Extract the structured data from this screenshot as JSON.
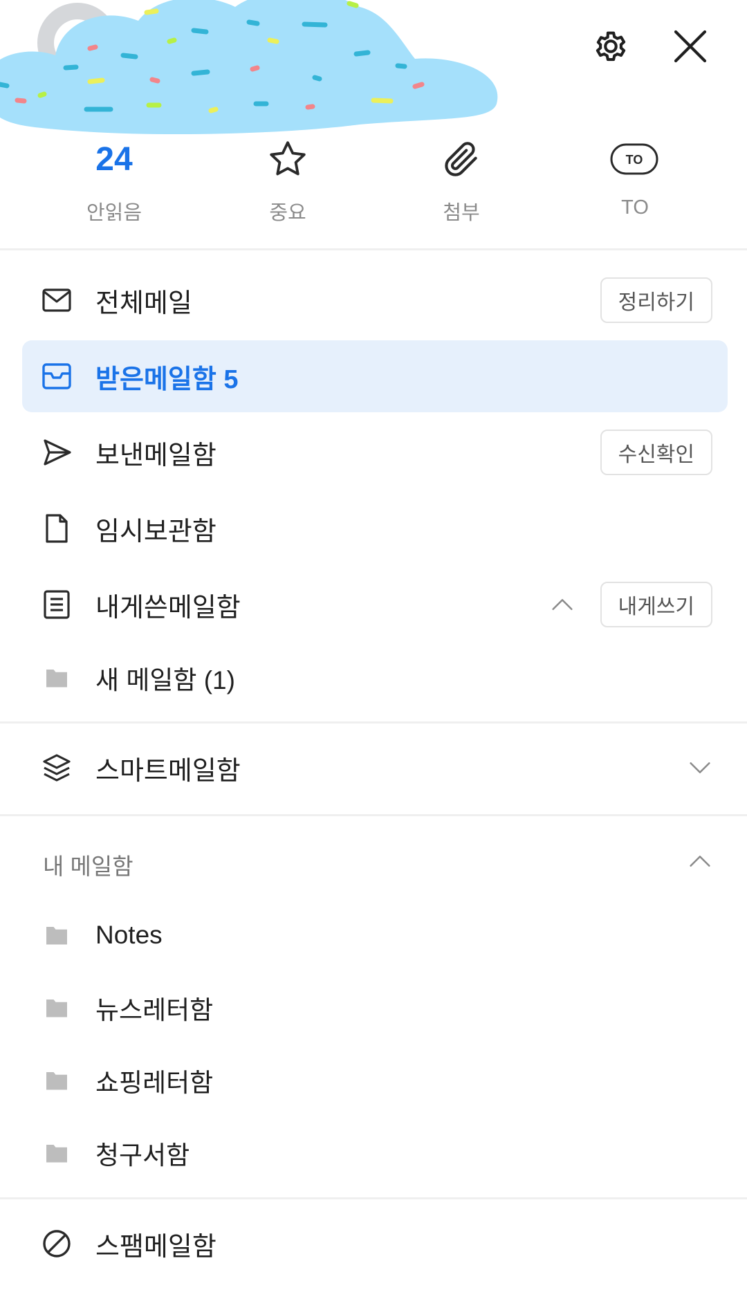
{
  "header": {
    "settings_icon": "gear-icon",
    "close_icon": "close-icon",
    "quick_filters": [
      {
        "label": "안읽음",
        "value": "24"
      },
      {
        "label": "중요",
        "icon": "star-icon"
      },
      {
        "label": "첨부",
        "icon": "paperclip-icon"
      },
      {
        "label": "TO",
        "icon": "to-badge-icon",
        "badge": "TO"
      }
    ]
  },
  "mailboxes": {
    "all": {
      "label": "전체메일",
      "action": "정리하기"
    },
    "inbox": {
      "label": "받은메일함",
      "count": "5"
    },
    "sent": {
      "label": "보낸메일함",
      "action": "수신확인"
    },
    "drafts": {
      "label": "임시보관함"
    },
    "self": {
      "label": "내게쓴메일함",
      "action": "내게쓰기"
    },
    "self_sub": {
      "label": "새 메일함 (1)"
    },
    "smart": {
      "label": "스마트메일함"
    }
  },
  "my_mailboxes": {
    "title": "내 메일함",
    "items": [
      {
        "label": "Notes"
      },
      {
        "label": "뉴스레터함"
      },
      {
        "label": "쇼핑레터함"
      },
      {
        "label": "청구서함"
      }
    ]
  },
  "spam": {
    "label": "스팸메일함"
  },
  "colors": {
    "accent": "#1a73e8",
    "selected_bg": "#e6f0fc",
    "cloud": "#a5e0fb"
  }
}
